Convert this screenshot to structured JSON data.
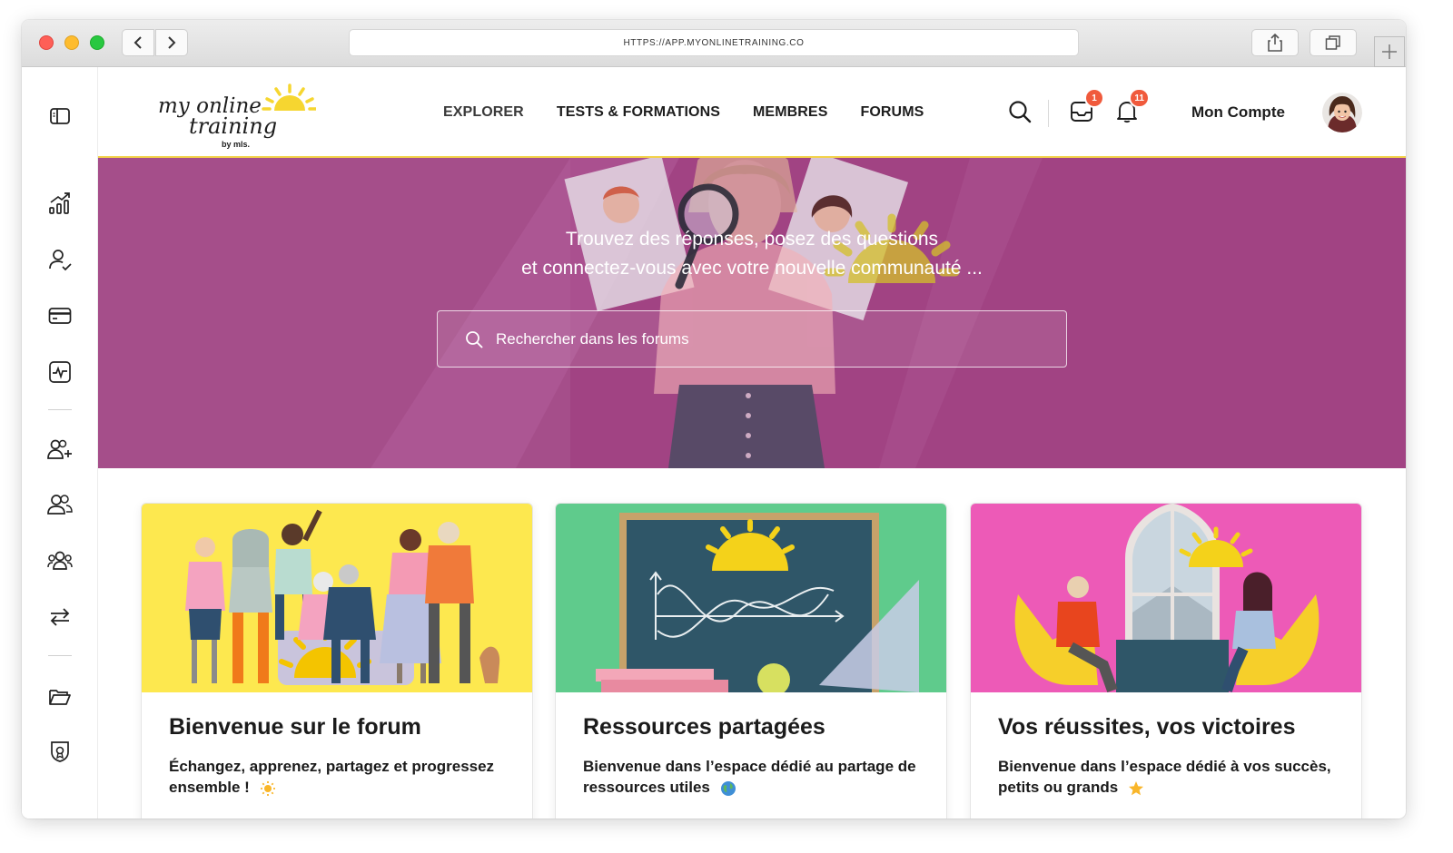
{
  "browser": {
    "url": "HTTPS://APP.MYONLINETRAINING.CO"
  },
  "brand": {
    "logo_line1": "my online",
    "logo_line2": "training",
    "logo_by": "by mls.",
    "accent_yellow": "#f3d24a",
    "hero_purple": "#a14383"
  },
  "nav": {
    "links": [
      {
        "label": "EXPLORER",
        "active": true
      },
      {
        "label": "TESTS & FORMATIONS",
        "active": false
      },
      {
        "label": "MEMBRES",
        "active": false
      },
      {
        "label": "FORUMS",
        "active": false
      }
    ],
    "inbox_badge": "1",
    "bell_badge": "11",
    "account_label": "Mon Compte"
  },
  "sidebar": {
    "icons": [
      "panel-toggle-icon",
      "analytics-icon",
      "user-check-icon",
      "credit-card-icon",
      "activity-monitor-icon",
      "add-user-icon",
      "users-icon",
      "group-icon",
      "transfer-icon",
      "folder-icon",
      "certificate-icon"
    ]
  },
  "hero": {
    "line1": "Trouvez des réponses, posez des questions",
    "line2": "et connectez-vous avec votre nouvelle communauté ...",
    "search_placeholder": "Rechercher dans les forums"
  },
  "cards": [
    {
      "title": "Bienvenue sur le forum",
      "desc": "Échangez, apprenez, partagez et progressez ensemble !",
      "emoji": "sun-emoji",
      "bg": "#fde84f"
    },
    {
      "title": "Ressources partagées",
      "desc": "Bienvenue dans l’espace dédié au partage de ressources utiles",
      "emoji": "globe-emoji",
      "bg": "#5fcb8c"
    },
    {
      "title": "Vos réussites, vos victoires",
      "desc": "Bienvenue dans l’espace dédié à vos succès, petits ou grands",
      "emoji": "star-emoji",
      "bg": "#ed5ab7"
    }
  ]
}
